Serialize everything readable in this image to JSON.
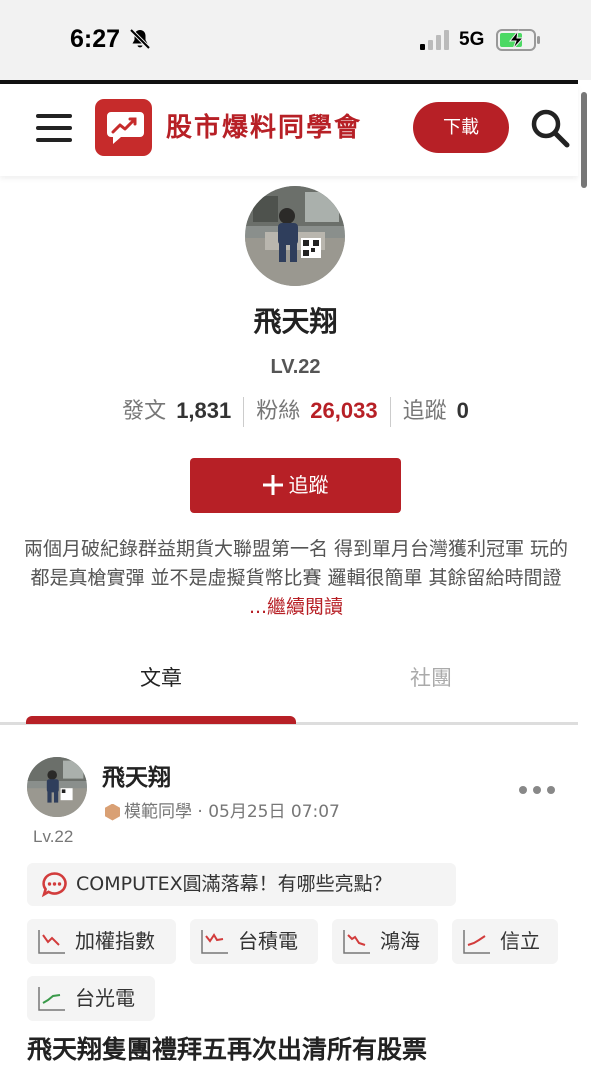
{
  "status_bar": {
    "time": "6:27",
    "network": "5G"
  },
  "header": {
    "brand": "股市爆料同學會",
    "download_label": "下載"
  },
  "profile": {
    "name": "飛天翔",
    "level": "LV.22",
    "stats": [
      {
        "label": "發文",
        "value": "1,831"
      },
      {
        "label": "粉絲",
        "value": "26,033"
      },
      {
        "label": "追蹤",
        "value": "0"
      }
    ],
    "follow_label": "追蹤",
    "bio": "兩個月破紀錄群益期貨大聯盟第一名 得到單月台灣獲利冠軍 玩的都是真槍實彈 並不是虛擬貨幣比賽 邏輯很簡單 其餘留給時間證",
    "read_more": "...繼續閱讀"
  },
  "tabs": [
    {
      "label": "文章"
    },
    {
      "label": "社團"
    }
  ],
  "post": {
    "author": "飛天翔",
    "badge": "模範同學",
    "date": "05月25日 07:07",
    "level": "Lv.22",
    "topic": "COMPUTEX圓滿落幕！有哪些亮點？",
    "stocks": [
      {
        "name": "加權指數"
      },
      {
        "name": "台積電"
      },
      {
        "name": "鴻海"
      },
      {
        "name": "信立"
      },
      {
        "name": "台光電"
      }
    ],
    "title": "飛天翔隻團禮拜五再次出清所有股票"
  },
  "colors": {
    "brand_red": "#b72026",
    "stock_down": "#d23c3c",
    "stock_up": "#3a9a4a"
  }
}
